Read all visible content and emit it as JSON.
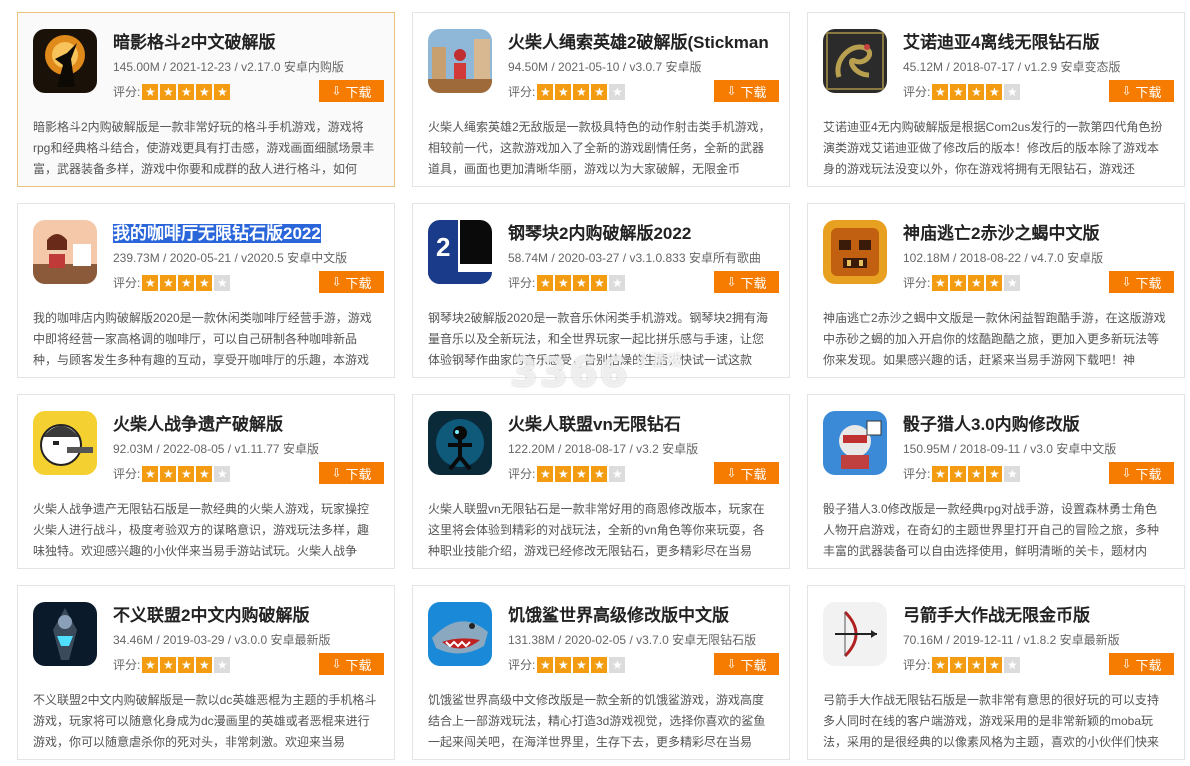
{
  "labels": {
    "rating": "评分:",
    "download": "下载"
  },
  "watermark": {
    "main": "3366",
    "sub": "小游戏"
  },
  "games": [
    {
      "title": "暗影格斗2中文破解版",
      "size": "145.00M",
      "date": "2021-12-23",
      "version": "v2.17.0",
      "type": "安卓内购版",
      "stars": 5,
      "icon": "shadow-fight-icon",
      "desc": "暗影格斗2内购破解版是一款非常好玩的格斗手机游戏，游戏将rpg和经典格斗结合，使游戏更具有打击感，游戏画面细腻场景丰富，武器装备多样，游戏中你要和成群的敌人进行格斗，如何"
    },
    {
      "title": "火柴人绳索英雄2破解版(Stickman",
      "size": "94.50M",
      "date": "2021-05-10",
      "version": "v3.0.7",
      "type": "安卓版",
      "stars": 4,
      "icon": "stickman-rope-hero-icon",
      "desc": "火柴人绳索英雄2无敌版是一款极具特色的动作射击类手机游戏，相较前一代，这款游戏加入了全新的游戏剧情任务，全新的武器道具，画面也更加清晰华丽，游戏以为大家破解，无限金币"
    },
    {
      "title": "艾诺迪亚4离线无限钻石版",
      "size": "45.12M",
      "date": "2018-07-17",
      "version": "v1.2.9",
      "type": "安卓变态版",
      "stars": 4,
      "icon": "inotia-dragon-icon",
      "desc": "艾诺迪亚4无内购破解版是根据Com2us发行的一款第四代角色扮演类游戏艾诺迪亚做了修改后的版本！修改后的版本除了游戏本身的游戏玩法没变以外，你在游戏将拥有无限钻石，游戏还"
    },
    {
      "title": "我的咖啡厅无限钻石版2022",
      "size": "239.73M",
      "date": "2020-05-21",
      "version": "v2020.5",
      "type": "安卓中文版",
      "stars": 4,
      "icon": "my-cafe-icon",
      "desc": "我的咖啡店内购破解版2020是一款休闲类咖啡厅经营手游，游戏中即将经营一家高格调的咖啡厅，可以自己研制各种咖啡新品种，与顾客发生多种有趣的互动，享受开咖啡厅的乐趣，本游戏"
    },
    {
      "title": "钢琴块2内购破解版2022",
      "size": "58.74M",
      "date": "2020-03-27",
      "version": "v3.1.0.833",
      "type": "安卓所有歌曲",
      "stars": 4,
      "icon": "piano-tiles-2-icon",
      "desc": "钢琴块2破解版2020是一款音乐休闲类手机游戏。钢琴块2拥有海量音乐以及全新玩法，和全世界玩家一起比拼乐感与手速，让您体验钢琴作曲家的音乐感受，告别枯燥的生活，快试一试这款"
    },
    {
      "title": "神庙逃亡2赤沙之蝎中文版",
      "size": "102.18M",
      "date": "2018-08-22",
      "version": "v4.7.0",
      "type": "安卓版",
      "stars": 4,
      "icon": "temple-run-icon",
      "desc": "神庙逃亡2赤沙之蝎中文版是一款休闲益智跑酷手游，在这版游戏中赤砂之蝎的加入开启你的炫酷跑酷之旅，更加入更多新玩法等你来发现。如果感兴趣的话，赶紧来当易手游网下载吧！神"
    },
    {
      "title": "火柴人战争遗产破解版",
      "size": "92.03M",
      "date": "2022-08-05",
      "version": "v1.11.77",
      "type": "安卓版",
      "stars": 4,
      "icon": "stick-war-icon",
      "desc": "火柴人战争遗产无限钻石版是一款经典的火柴人游戏，玩家操控火柴人进行战斗，极度考验双方的谋略意识，游戏玩法多样，趣味独特。欢迎感兴趣的小伙伴来当易手游站试玩。火柴人战争"
    },
    {
      "title": "火柴人联盟vn无限钻石",
      "size": "122.20M",
      "date": "2018-08-17",
      "version": "v3.2",
      "type": "安卓版",
      "stars": 4,
      "icon": "stickman-league-icon",
      "desc": "火柴人联盟vn无限钻石是一款非常好用的商恩修改版本，玩家在这里将会体验到精彩的对战玩法，全新的vn角色等你来玩耍，各种职业技能介绍，游戏已经修改无限钻石，更多精彩尽在当易"
    },
    {
      "title": "骰子猎人3.0内购修改版",
      "size": "150.95M",
      "date": "2018-09-11",
      "version": "v3.0",
      "type": "安卓中文版",
      "stars": 4,
      "icon": "dice-hunter-icon",
      "desc": "骰子猎人3.0修改版是一款经典rpg对战手游，设置森林勇士角色人物开启游戏，在奇幻的主题世界里打开自己的冒险之旅，多种丰富的武器装备可以自由选择使用，鲜明清晰的关卡，题材内"
    },
    {
      "title": "不义联盟2中文内购破解版",
      "size": "34.46M",
      "date": "2019-03-29",
      "version": "v3.0.0",
      "type": "安卓最新版",
      "stars": 4,
      "icon": "injustice-2-icon",
      "desc": "不义联盟2中文内购破解版是一款以dc英雄恶棍为主题的手机格斗游戏，玩家将可以随意化身成为dc漫画里的英雄或者恶棍来进行游戏，你可以随意虐杀你的死对头，非常刺激。欢迎来当易"
    },
    {
      "title": "饥饿鲨世界高级修改版中文版",
      "size": "131.38M",
      "date": "2020-02-05",
      "version": "v3.7.0",
      "type": "安卓无限钻石版",
      "stars": 4,
      "icon": "hungry-shark-icon",
      "desc": "饥饿鲨世界高级中文修改版是一款全新的饥饿鲨游戏，游戏高度结合上一部游戏玩法，精心打造3d游戏视觉，选择你喜欢的鲨鱼一起来闯关吧，在海洋世界里，生存下去，更多精彩尽在当易"
    },
    {
      "title": "弓箭手大作战无限金币版",
      "size": "70.16M",
      "date": "2019-12-11",
      "version": "v1.8.2",
      "type": "安卓最新版",
      "stars": 4,
      "icon": "archer-bow-icon",
      "desc": "弓箭手大作战无限钻石版是一款非常有意思的很好玩的可以支持多人同时在线的客户端游戏，游戏采用的是非常新颖的moba玩法，采用的是很经典的以像素风格为主题，喜欢的小伙伴们快来"
    }
  ]
}
